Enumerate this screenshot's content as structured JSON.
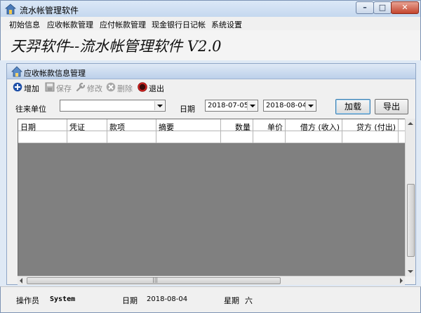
{
  "window": {
    "title": "流水帐管理软件",
    "controls": [
      "minimize",
      "maximize",
      "close"
    ]
  },
  "menu": [
    "初始信息",
    "应收帐款管理",
    "应付帐款管理",
    "现金银行日记帐",
    "系统设置"
  ],
  "banner": {
    "title": "天羿软件--流水帐管理软件 V2.0"
  },
  "panel": {
    "title": "应收帐款信息管理",
    "toolbar": [
      {
        "label": "增加",
        "icon": "add-icon",
        "enabled": true
      },
      {
        "label": "保存",
        "icon": "save-icon",
        "enabled": false
      },
      {
        "label": "修改",
        "icon": "wrench-icon",
        "enabled": false
      },
      {
        "label": "删除",
        "icon": "delete-icon",
        "enabled": false
      },
      {
        "label": "退出",
        "icon": "exit-icon",
        "enabled": true
      }
    ],
    "filter": {
      "partner_label": "往来单位",
      "partner_value": "",
      "date_label": "日期",
      "date_from": "2018-07-05",
      "date_to": "2018-08-04",
      "load_label": "加载",
      "export_label": "导出"
    },
    "grid": {
      "columns": [
        "日期",
        "凭证",
        "款项",
        "摘要",
        "数量",
        "单价",
        "借方 (收入)",
        "贷方 (付出)"
      ]
    }
  },
  "status": {
    "operator_label": "操作员",
    "operator_value": "System",
    "date_label": "日期",
    "date_value": "2018-08-04",
    "weekday_label": "星期",
    "weekday_value": "六"
  },
  "colors": {
    "grid_background": "#808080",
    "title_gradient": "#c5d8ef"
  }
}
